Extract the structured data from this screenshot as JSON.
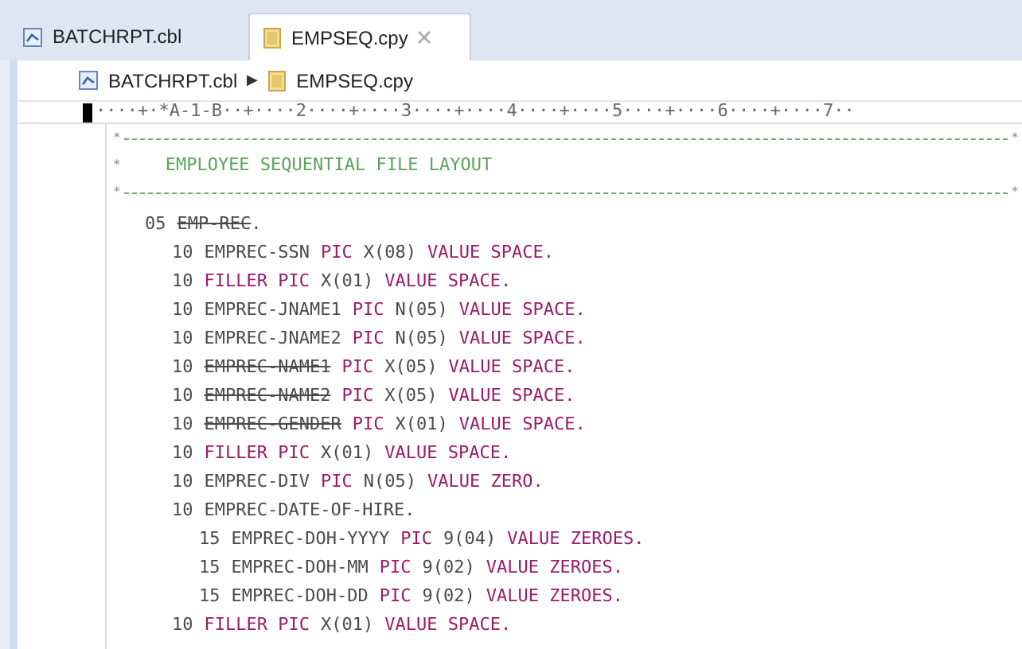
{
  "tabs": [
    {
      "label": "BATCHRPT.cbl",
      "kind": "cobol",
      "selected": false,
      "closable": false
    },
    {
      "label": "EMPSEQ.cpy",
      "kind": "copybook",
      "selected": true,
      "closable": true
    }
  ],
  "breadcrumb": [
    {
      "label": "BATCHRPT.cbl",
      "kind": "cobol"
    },
    {
      "label": "EMPSEQ.cpy",
      "kind": "copybook"
    }
  ],
  "breadcrumb_separator": "▶",
  "ruler": "····+·*A-1-B··+····2····+····3····+····4····+····5····+····6····+····7··",
  "comment_block": [
    {
      "kind": "rule",
      "marker": "*",
      "end_marker": "*"
    },
    {
      "kind": "text",
      "marker": "*",
      "text": "EMPLOYEE SEQUENTIAL FILE LAYOUT"
    },
    {
      "kind": "rule",
      "marker": "*",
      "end_marker": "*"
    }
  ],
  "code": [
    {
      "tokens": [
        {
          "kind": "plain",
          "text": "05"
        },
        {
          "kind": "strike",
          "text": "EMP-REC"
        },
        {
          "kind": "plain",
          "text": ".",
          "attached": true
        }
      ],
      "children": [
        {
          "tokens": [
            {
              "kind": "plain",
              "text": "10"
            },
            {
              "kind": "plain",
              "text": "EMPREC-SSN"
            },
            {
              "kind": "keyword",
              "text": "PIC"
            },
            {
              "kind": "plain",
              "text": "X(08)"
            },
            {
              "kind": "keyword",
              "text": "VALUE SPACE."
            }
          ]
        },
        {
          "tokens": [
            {
              "kind": "plain",
              "text": "10"
            },
            {
              "kind": "keyword",
              "text": "FILLER PIC"
            },
            {
              "kind": "plain",
              "text": "X(01)"
            },
            {
              "kind": "keyword",
              "text": "VALUE SPACE."
            }
          ]
        },
        {
          "tokens": [
            {
              "kind": "plain",
              "text": "10"
            },
            {
              "kind": "plain",
              "text": "EMPREC-JNAME1"
            },
            {
              "kind": "keyword",
              "text": "PIC"
            },
            {
              "kind": "plain",
              "text": "N(05)"
            },
            {
              "kind": "keyword",
              "text": "VALUE SPACE."
            }
          ]
        },
        {
          "tokens": [
            {
              "kind": "plain",
              "text": "10"
            },
            {
              "kind": "plain",
              "text": "EMPREC-JNAME2"
            },
            {
              "kind": "keyword",
              "text": "PIC"
            },
            {
              "kind": "plain",
              "text": "N(05)"
            },
            {
              "kind": "keyword",
              "text": "VALUE SPACE."
            }
          ]
        },
        {
          "tokens": [
            {
              "kind": "plain",
              "text": "10"
            },
            {
              "kind": "strike",
              "text": "EMPREC-NAME1"
            },
            {
              "kind": "keyword",
              "text": "PIC"
            },
            {
              "kind": "plain",
              "text": "X(05)"
            },
            {
              "kind": "keyword",
              "text": "VALUE SPACE."
            }
          ]
        },
        {
          "tokens": [
            {
              "kind": "plain",
              "text": "10"
            },
            {
              "kind": "strike",
              "text": "EMPREC-NAME2"
            },
            {
              "kind": "keyword",
              "text": "PIC"
            },
            {
              "kind": "plain",
              "text": "X(05)"
            },
            {
              "kind": "keyword",
              "text": "VALUE SPACE."
            }
          ]
        },
        {
          "tokens": [
            {
              "kind": "plain",
              "text": "10"
            },
            {
              "kind": "strike",
              "text": "EMPREC-GENDER"
            },
            {
              "kind": "keyword",
              "text": "PIC"
            },
            {
              "kind": "plain",
              "text": "X(01)"
            },
            {
              "kind": "keyword",
              "text": "VALUE SPACE."
            }
          ]
        },
        {
          "tokens": [
            {
              "kind": "plain",
              "text": "10"
            },
            {
              "kind": "keyword",
              "text": "FILLER PIC"
            },
            {
              "kind": "plain",
              "text": "X(01)"
            },
            {
              "kind": "keyword",
              "text": "VALUE SPACE."
            }
          ]
        },
        {
          "tokens": [
            {
              "kind": "plain",
              "text": "10"
            },
            {
              "kind": "plain",
              "text": "EMPREC-DIV"
            },
            {
              "kind": "keyword",
              "text": "PIC"
            },
            {
              "kind": "plain",
              "text": "N(05)"
            },
            {
              "kind": "keyword",
              "text": "VALUE ZERO."
            }
          ]
        },
        {
          "tokens": [
            {
              "kind": "plain",
              "text": "10"
            },
            {
              "kind": "plain",
              "text": "EMPREC-DATE-OF-HIRE."
            }
          ],
          "children": [
            {
              "tokens": [
                {
                  "kind": "plain",
                  "text": "15"
                },
                {
                  "kind": "plain",
                  "text": "EMPREC-DOH-YYYY"
                },
                {
                  "kind": "keyword",
                  "text": "PIC"
                },
                {
                  "kind": "plain",
                  "text": "9(04)"
                },
                {
                  "kind": "keyword",
                  "text": "VALUE ZEROES."
                }
              ]
            },
            {
              "tokens": [
                {
                  "kind": "plain",
                  "text": "15"
                },
                {
                  "kind": "plain",
                  "text": "EMPREC-DOH-MM"
                },
                {
                  "kind": "keyword",
                  "text": "PIC"
                },
                {
                  "kind": "plain",
                  "text": "9(02)"
                },
                {
                  "kind": "keyword",
                  "text": "VALUE ZEROES."
                }
              ]
            },
            {
              "tokens": [
                {
                  "kind": "plain",
                  "text": "15"
                },
                {
                  "kind": "plain",
                  "text": "EMPREC-DOH-DD"
                },
                {
                  "kind": "keyword",
                  "text": "PIC"
                },
                {
                  "kind": "plain",
                  "text": "9(02)"
                },
                {
                  "kind": "keyword",
                  "text": "VALUE ZEROES."
                }
              ]
            }
          ]
        },
        {
          "tokens": [
            {
              "kind": "plain",
              "text": "10"
            },
            {
              "kind": "keyword",
              "text": "FILLER PIC"
            },
            {
              "kind": "plain",
              "text": "X(01)"
            },
            {
              "kind": "keyword",
              "text": "VALUE SPACE."
            }
          ]
        }
      ]
    }
  ]
}
